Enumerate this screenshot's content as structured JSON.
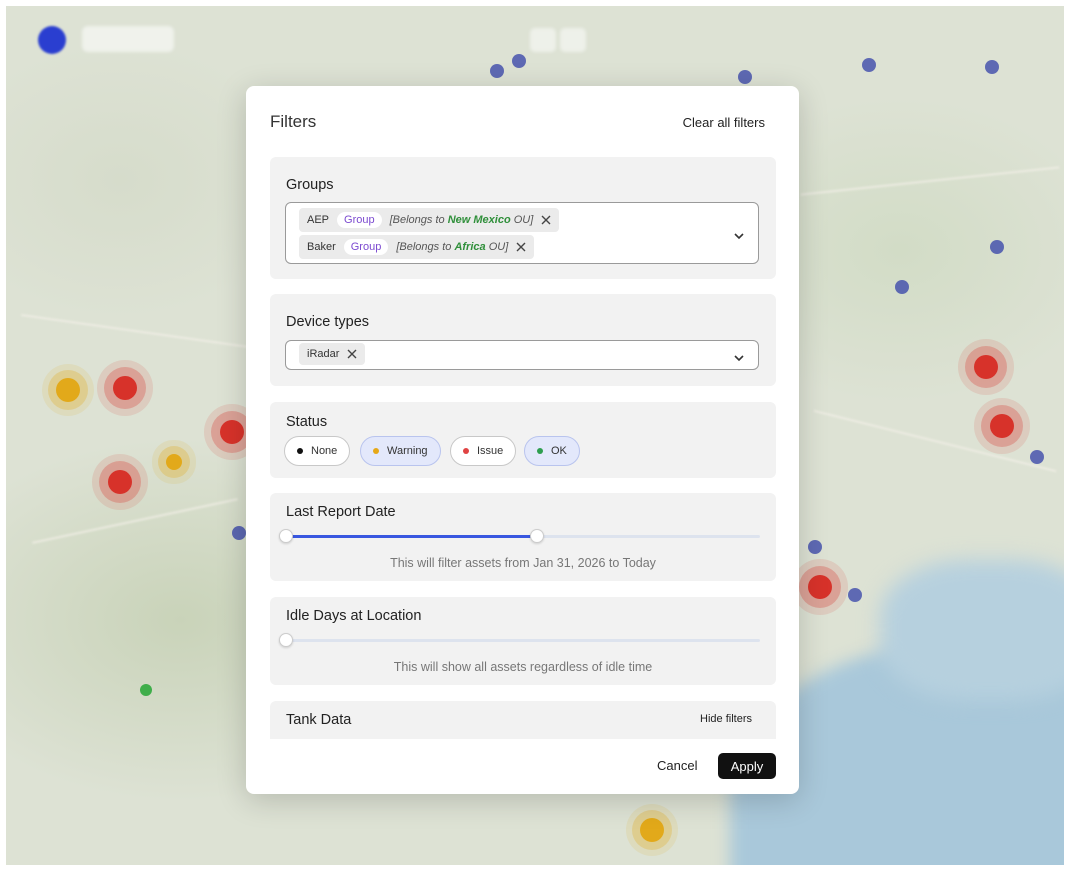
{
  "modal": {
    "title": "Filters",
    "clear_all_label": "Clear all filters",
    "cancel_label": "Cancel",
    "apply_label": "Apply"
  },
  "groups": {
    "label": "Groups",
    "chips": [
      {
        "name": "AEP",
        "tag": "Group",
        "belongs_prefix": "[Belongs to",
        "ou": "New Mexico",
        "belongs_suffix": "OU]"
      },
      {
        "name": "Baker",
        "tag": "Group",
        "belongs_prefix": "[Belongs to",
        "ou": "Africa",
        "belongs_suffix": "OU]"
      }
    ]
  },
  "device_types": {
    "label": "Device types",
    "chips": [
      {
        "name": "iRadar"
      }
    ]
  },
  "status": {
    "label": "Status",
    "options": [
      {
        "label": "None",
        "color": "#111111",
        "selected": false
      },
      {
        "label": "Warning",
        "color": "#e6a817",
        "selected": true
      },
      {
        "label": "Issue",
        "color": "#e04343",
        "selected": false
      },
      {
        "label": "OK",
        "color": "#2e9e4f",
        "selected": true
      }
    ]
  },
  "last_report": {
    "label": "Last Report Date",
    "hint": "This will filter assets from Jan 31, 2026 to Today",
    "slider_fraction": 0.53
  },
  "idle_days": {
    "label": "Idle Days at Location",
    "hint": "This will show all assets regardless of idle time",
    "slider_fraction": 0
  },
  "tank_data": {
    "label": "Tank Data",
    "hide_label": "Hide filters"
  },
  "colors": {
    "accent": "#3957e0",
    "apply_bg": "#111111",
    "group_tag": "#7c4ad0",
    "ou_name": "#2f8f3a"
  }
}
